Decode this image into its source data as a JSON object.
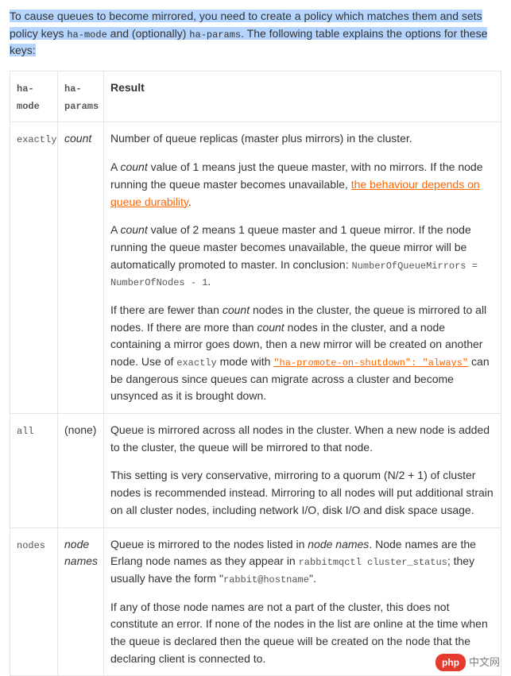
{
  "intro": {
    "pre": "To cause queues to become mirrored, you need to create a policy which matches them and sets policy keys ",
    "code1": "ha-mode",
    "mid1": " and (optionally) ",
    "code2": "ha-params",
    "post": ". The following table explains the options for these keys:"
  },
  "table": {
    "headers": {
      "c1": "ha-mode",
      "c2": "ha-params",
      "c3": "Result"
    },
    "rows": [
      {
        "mode": "exactly",
        "params_italic": "count",
        "result": {
          "p1": "Number of queue replicas (master plus mirrors) in the cluster.",
          "p2_a": "A ",
          "p2_em1": "count",
          "p2_b": " value of 1 means just the queue master, with no mirrors. If the node running the queue master becomes unavailable, ",
          "p2_link": "the behaviour depends on queue durability",
          "p2_c": ".",
          "p3_a": "A ",
          "p3_em1": "count",
          "p3_b": " value of 2 means 1 queue master and 1 queue mirror. If the node running the queue master becomes unavailable, the queue mirror will be automatically promoted to master. In conclusion: ",
          "p3_code": "NumberOfQueueMirrors = NumberOfNodes - 1",
          "p3_c": ".",
          "p4_a": "If there are fewer than ",
          "p4_em1": "count",
          "p4_b": " nodes in the cluster, the queue is mirrored to all nodes. If there are more than ",
          "p4_em2": "count",
          "p4_c": " nodes in the cluster, and a node containing a mirror goes down, then a new mirror will be created on another node. Use of ",
          "p4_code1": "exactly",
          "p4_d": " mode with ",
          "p4_link": "\"ha-promote-on-shutdown\": \"always\"",
          "p4_e": " can be dangerous since queues can migrate across a cluster and become unsynced as it is brought down."
        }
      },
      {
        "mode": "all",
        "params_plain": "(none)",
        "result": {
          "p1": "Queue is mirrored across all nodes in the cluster. When a new node is added to the cluster, the queue will be mirrored to that node.",
          "p2": "This setting is very conservative, mirroring to a quorum (N/2 + 1) of cluster nodes is recommended instead. Mirroring to all nodes will put additional strain on all cluster nodes, including network I/O, disk I/O and disk space usage."
        }
      },
      {
        "mode": "nodes",
        "params_italic": "node names",
        "result": {
          "p1_a": "Queue is mirrored to the nodes listed in ",
          "p1_em": "node names",
          "p1_b": ". Node names are the Erlang node names as they appear in ",
          "p1_code": "rabbitmqctl cluster_status",
          "p1_c": "; they usually have the form \"",
          "p1_code2": "rabbit@hostname",
          "p1_d": "\".",
          "p2": "If any of those node names are not a part of the cluster, this does not constitute an error. If none of the nodes in the list are online at the time when the queue is declared then the queue will be created on the node that the declaring client is connected to."
        }
      }
    ]
  },
  "watermark": {
    "badge": "php",
    "text": "中文网"
  }
}
